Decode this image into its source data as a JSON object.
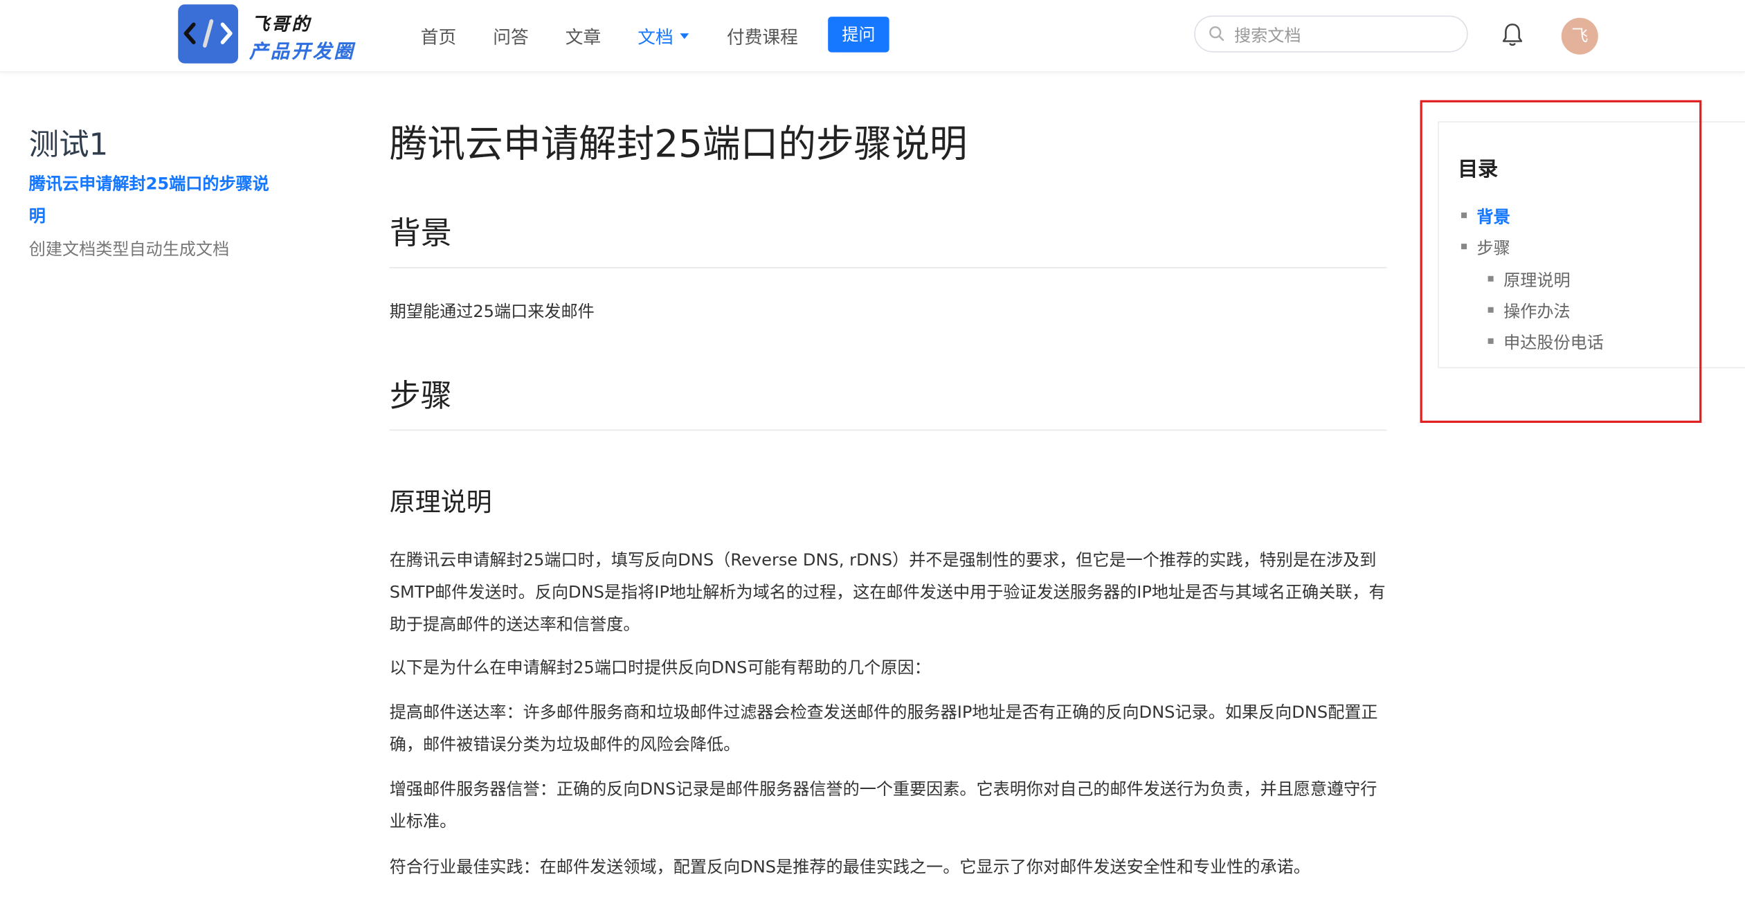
{
  "header": {
    "logo_line1": "飞哥的",
    "logo_line2": "产品开发圈",
    "nav": {
      "home": "首页",
      "qa": "问答",
      "articles": "文章",
      "docs": "文档",
      "courses": "付费课程"
    },
    "ask_button": "提问",
    "search_placeholder": "搜索文档",
    "avatar_initial": "飞"
  },
  "sidebar": {
    "group_title": "测试1",
    "items": [
      {
        "label": "腾讯云申请解封25端口的步骤说明",
        "active": true
      },
      {
        "label": "创建文档类型自动生成文档",
        "active": false
      }
    ]
  },
  "article": {
    "title": "腾讯云申请解封25端口的步骤说明",
    "section_background": "背景",
    "background_text": "期望能通过25端口来发邮件",
    "section_steps": "步骤",
    "sub_principle": "原理说明",
    "p1": "在腾讯云申请解封25端口时，填写反向DNS（Reverse DNS, rDNS）并不是强制性的要求，但它是一个推荐的实践，特别是在涉及到SMTP邮件发送时。反向DNS是指将IP地址解析为域名的过程，这在邮件发送中用于验证发送服务器的IP地址是否与其域名正确关联，有助于提高邮件的送达率和信誉度。",
    "p2": "以下是为什么在申请解封25端口时提供反向DNS可能有帮助的几个原因：",
    "p3": "提高邮件送达率：许多邮件服务商和垃圾邮件过滤器会检查发送邮件的服务器IP地址是否有正确的反向DNS记录。如果反向DNS配置正确，邮件被错误分类为垃圾邮件的风险会降低。",
    "p4": "增强邮件服务器信誉：正确的反向DNS记录是邮件服务器信誉的一个重要因素。它表明你对自己的邮件发送行为负责，并且愿意遵守行业标准。",
    "p5": "符合行业最佳实践：在邮件发送领域，配置反向DNS是推荐的最佳实践之一。它显示了你对邮件发送安全性和专业性的承诺。"
  },
  "toc": {
    "title": "目录",
    "items": [
      {
        "label": "背景",
        "level": 1,
        "active": true
      },
      {
        "label": "步骤",
        "level": 1,
        "active": false
      },
      {
        "label": "原理说明",
        "level": 2,
        "active": false
      },
      {
        "label": "操作办法",
        "level": 2,
        "active": false
      },
      {
        "label": "申达股份电话",
        "level": 2,
        "active": false
      }
    ]
  },
  "colors": {
    "accent": "#1677ff",
    "highlight_box": "#e02020",
    "logo_badge": "#3a6fd8"
  }
}
